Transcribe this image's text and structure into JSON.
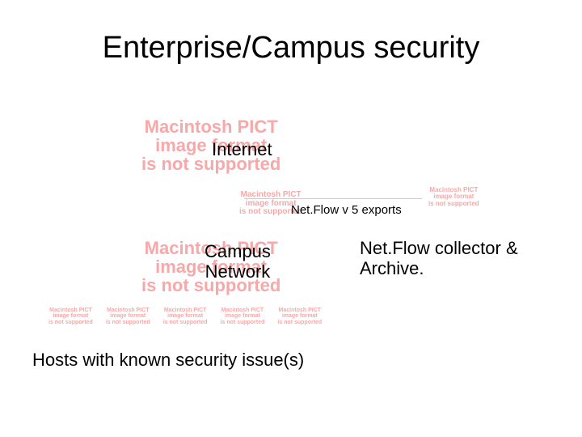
{
  "title": "Enterprise/Campus security",
  "pict": {
    "line1": "Macintosh PICT",
    "line2": "image format",
    "line3": "is not supported"
  },
  "labels": {
    "internet": "Internet",
    "netflow_exports": "Net.Flow v 5 exports",
    "campus_network_l1": "Campus",
    "campus_network_l2": "Network",
    "collector_l1": "Net.Flow collector &",
    "collector_l2": "Archive.",
    "hosts": "Hosts with known security issue(s)"
  }
}
